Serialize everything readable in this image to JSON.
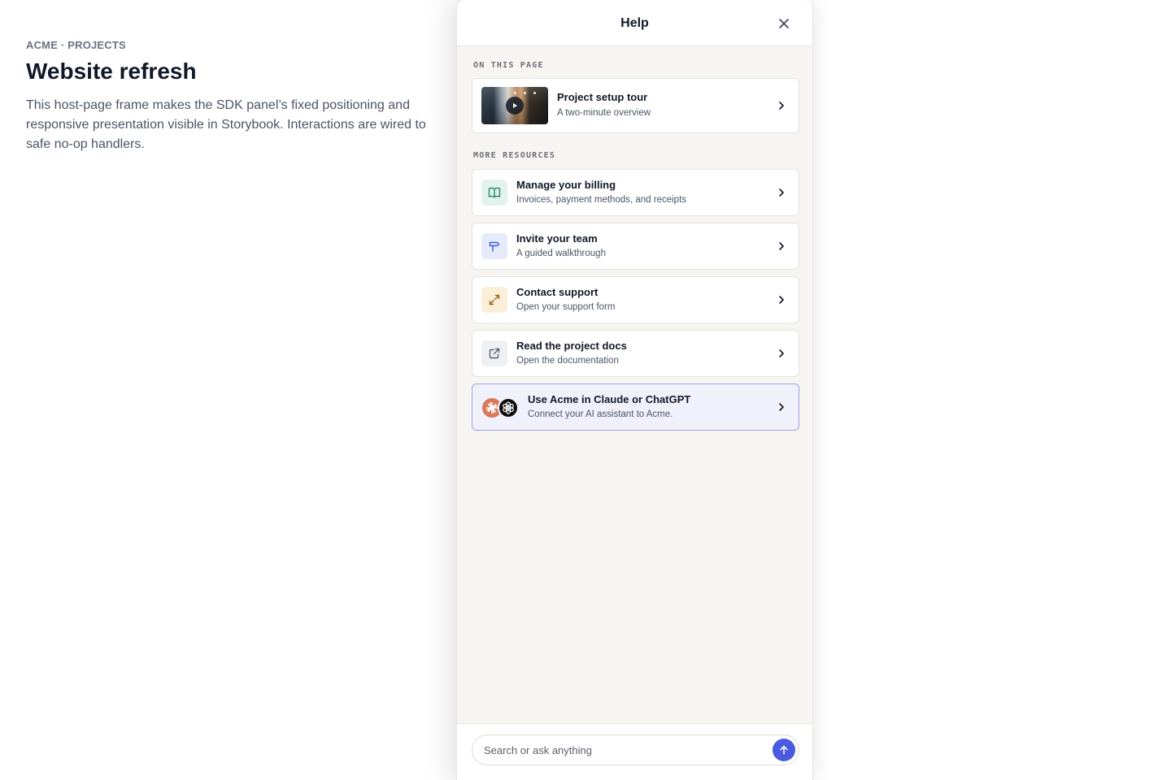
{
  "host": {
    "breadcrumb": "ACME · PROJECTS",
    "title": "Website refresh",
    "description": "This host-page frame makes the SDK panel’s fixed positioning and responsive presentation visible in Storybook. Interactions are wired to safe no-op handlers."
  },
  "panel": {
    "title": "Help",
    "on_this_page_label": "ON THIS PAGE",
    "more_resources_label": "MORE RESOURCES",
    "featured": {
      "title": "Project setup tour",
      "subtitle": "A two-minute overview",
      "icon": "play-icon"
    },
    "resources": [
      {
        "title": "Manage your billing",
        "subtitle": "Invoices, payment methods, and receipts",
        "icon": "book-icon",
        "icon_bg": "#e3f2ed",
        "icon_color": "#1f8a6a"
      },
      {
        "title": "Invite your team",
        "subtitle": "A guided walkthrough",
        "icon": "signpost-icon",
        "icon_bg": "#e6ebfb",
        "icon_color": "#3b5bd6"
      },
      {
        "title": "Contact support",
        "subtitle": "Open your support form",
        "icon": "expand-icon",
        "icon_bg": "#fbefd9",
        "icon_color": "#9a6512"
      },
      {
        "title": "Read the project docs",
        "subtitle": "Open the documentation",
        "icon": "external-link-icon",
        "icon_bg": "#eef0f4",
        "icon_color": "#5b6170"
      }
    ],
    "ai": {
      "title": "Use Acme in Claude or ChatGPT",
      "subtitle": "Connect your AI assistant to Acme.",
      "icons": [
        "claude-logo-icon",
        "chatgpt-logo-icon"
      ],
      "accent": "#4a5be0"
    },
    "search": {
      "placeholder": "Search or ask anything",
      "value": ""
    }
  }
}
